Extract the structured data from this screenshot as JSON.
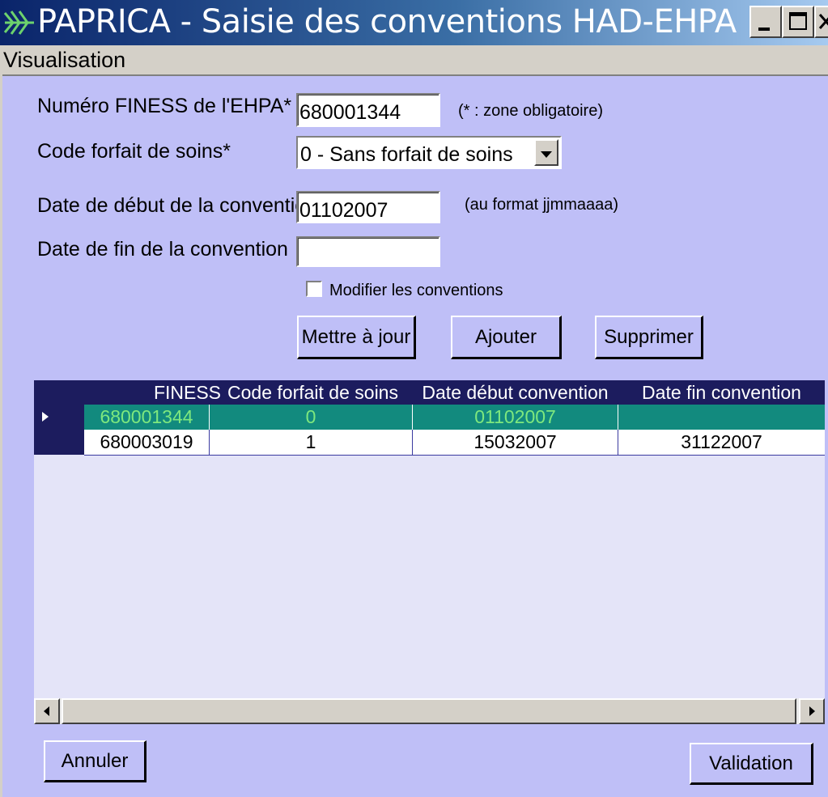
{
  "window": {
    "title": "PAPRICA - Saisie des conventions HAD-EHPA",
    "minimize_icon": "minimize-icon",
    "maximize_icon": "maximize-icon",
    "close_icon": "close-icon"
  },
  "menu": {
    "items": [
      "Visualisation"
    ]
  },
  "form": {
    "finess_label": "Numéro FINESS de l'EHPA*",
    "finess_value": "680001344",
    "mandatory_note": "(* : zone obligatoire)",
    "code_label": "Code forfait de soins*",
    "code_value": "0 - Sans forfait de soins",
    "date_debut_label": "Date de début de la convention*",
    "date_debut_value": "01102007",
    "date_format_note": "(au format jjmmaaaa)",
    "date_fin_label": "Date de fin de la convention",
    "date_fin_value": "",
    "modifier_label": "Modifier les conventions",
    "modifier_checked": false
  },
  "buttons": {
    "update": "Mettre à jour",
    "add": "Ajouter",
    "delete": "Supprimer",
    "cancel": "Annuler",
    "validate": "Validation"
  },
  "grid": {
    "columns": [
      "FINESS",
      "Code forfait de soins",
      "Date début convention",
      "Date fin convention"
    ],
    "rows": [
      [
        "680001344",
        "0",
        "01102007",
        ""
      ],
      [
        "680003019",
        "1",
        "15032007",
        "31122007"
      ]
    ],
    "selected_row": 0,
    "colors": {
      "header_bg": "#1c1c5e",
      "selected_bg": "#128a7e",
      "selected_text": "#7ee87e"
    }
  }
}
